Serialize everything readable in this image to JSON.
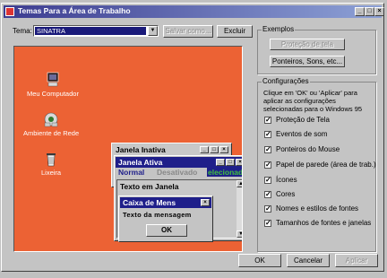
{
  "window": {
    "title": "Temas Para a Área de Trabalho"
  },
  "theme": {
    "label": "Tema:",
    "value": "SINATRA",
    "save_label": "Salvar como...",
    "delete_label": "Excluir"
  },
  "examples": {
    "label": "Exemplos",
    "screensaver_label": "Proteção de tela",
    "pointers_label": "Ponteiros, Sons, etc..."
  },
  "desktop_icons": [
    {
      "label": "Meu Computador"
    },
    {
      "label": "Ambiente de Rede"
    },
    {
      "label": "Lixeira"
    }
  ],
  "preview": {
    "inactive_title": "Janela Inativa",
    "active_title": "Janela Ativa",
    "menu": [
      "Normal",
      "Desativado",
      "elecionad"
    ],
    "window_text": "Texto em Janela",
    "message_title": "Caixa de Mens",
    "message_text": "Texto da mensagem",
    "ok_label": "OK"
  },
  "config": {
    "label": "Configurações",
    "description": "Clique em 'OK' ou 'Aplicar' para aplicar as configurações selecionadas para o Windows 95",
    "items": [
      {
        "label": "Proteção de Tela",
        "checked": true
      },
      {
        "label": "Eventos de som",
        "checked": true
      },
      {
        "label": "Ponteiros do Mouse",
        "checked": true
      },
      {
        "label": "Papel de parede (área de trab.)",
        "checked": true
      },
      {
        "label": "Ícones",
        "checked": true
      },
      {
        "label": "Cores",
        "checked": true
      },
      {
        "label": "Nomes e estilos de fontes",
        "checked": true
      },
      {
        "label": "Tamanhos de fontes e janelas",
        "checked": true
      }
    ]
  },
  "footer": {
    "ok_label": "OK",
    "cancel_label": "Cancelar",
    "apply_label": "Aplicar"
  }
}
